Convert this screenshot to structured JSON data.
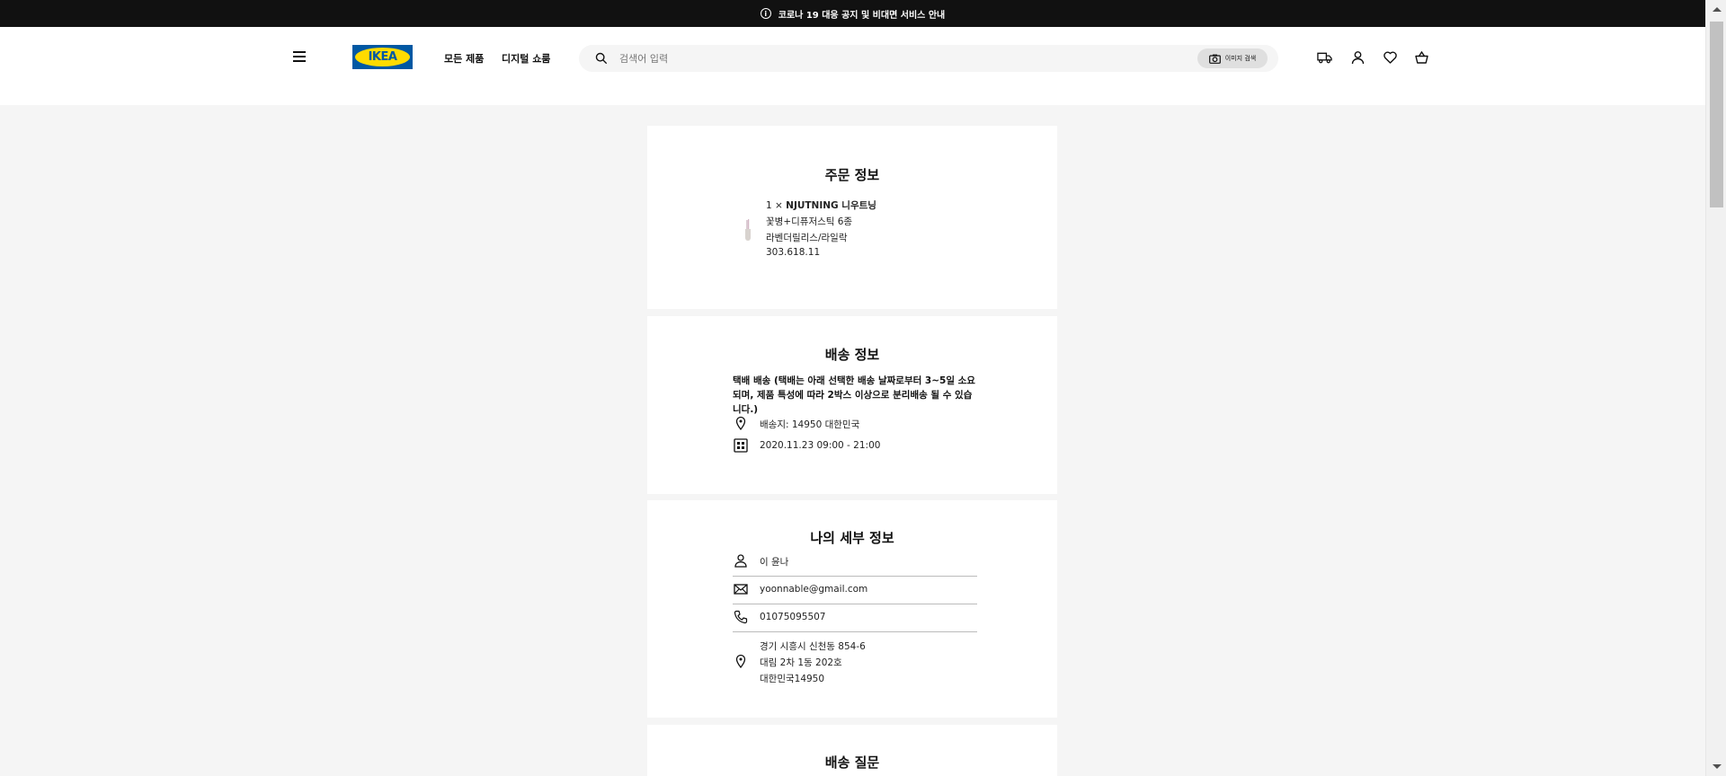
{
  "banner": {
    "text": "코로나 19 대응 공지 및 비대면 서비스 안내"
  },
  "header": {
    "logo_text": "IKEA",
    "nav": [
      "모든 제품",
      "디지털 쇼룸"
    ],
    "search": {
      "placeholder": "검색어 입력",
      "image_search_label": "이미지 검색"
    },
    "icons": [
      "delivery-truck-icon",
      "user-icon",
      "heart-icon",
      "shopping-bag-icon"
    ]
  },
  "order_info": {
    "title": "주문 정보",
    "product": {
      "quantity": "1 ×",
      "name": "NJUTNING 니우트닝",
      "description": "꽃병+디퓨저스틱 6종",
      "variant": "라벤더릴리스/라일락",
      "article_number": "303.618.11"
    }
  },
  "delivery_info": {
    "title": "배송 정보",
    "method": "택배 배송 (택배는 아래 선택한 배송 날짜로부터 3~5일 소요되며, 제품 특성에 따라 2박스 이상으로 분리배송 될 수 있습니다.)",
    "address": "배송지: 14950 대한민국",
    "date": "2020.11.23 09:00 - 21:00"
  },
  "my_details": {
    "title": "나의 세부 정보",
    "name": "이 윤나",
    "email": "yoonnable@gmail.com",
    "phone": "01075095507",
    "address_lines": [
      "경기 시흥시 신천동 854-6",
      "대림 2차 1동 202호",
      "대한민국14950"
    ]
  },
  "delivery_questions": {
    "title": "배송 질문"
  },
  "colors": {
    "banner_bg": "#111111",
    "page_bg": "#f5f5f5",
    "ikea_blue": "#0058a3",
    "ikea_yellow": "#ffdb00"
  }
}
